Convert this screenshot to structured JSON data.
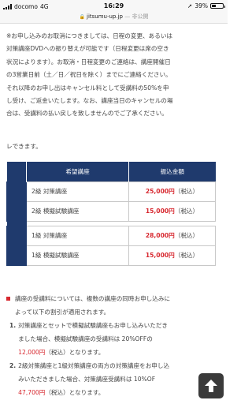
{
  "status_bar": {
    "carrier": "docomo",
    "network": "4G",
    "time": "16:29",
    "battery": "39%",
    "battery_level": 0.39
  },
  "url_bar": {
    "domain": "jitsumu-up.jp",
    "suffix": "— 非公開"
  },
  "intro": {
    "lines": [
      "※お申し込みのお取消につきましては、日程の変更、あるいは",
      "対策講座DVDへの振り替えが可能です（日程変更は席の空き",
      "状況によります）。お取消・日程変更のご連絡は、講座開催日",
      "の3営業日前（土／日／祝日を除く）までにご連絡ください。",
      "それ以降のお申し出はキャンセル料として受講料の50%を申",
      "し受け、ご返金いたします。なお、講座当日のキャンセルの場",
      "合は、受講料の払い戻しを致しませんのでご了承ください。"
    ],
    "tail": "レできます。"
  },
  "table": {
    "headers": [
      "希望講座",
      "振込金額"
    ],
    "groups": [
      {
        "rows": [
          {
            "course": "2級 対策講座",
            "amount": "25,000円",
            "tax": "（税込）"
          },
          {
            "course": "2級 模擬試験講座",
            "amount": "15,000円",
            "tax": "（税込）"
          }
        ]
      },
      {
        "rows": [
          {
            "course": "1級 対策講座",
            "amount": "28,000円",
            "tax": "（税込）"
          },
          {
            "course": "1級 模擬試験講座",
            "amount": "15,000円",
            "tax": "（税込）"
          }
        ]
      }
    ]
  },
  "notes": {
    "heading_line1": "講座の受講料については、複数の講座の同時お申し込みに",
    "heading_line2": "よって以下の割引が適用されます。",
    "item1": {
      "num": "1.",
      "line1": "対策講座とセットで模擬試験講座もお申し込みいただき",
      "line2": "ました場合、模擬試験講座の受講料は 20%OFFの",
      "price": "12,000円",
      "tax_suffix": "（税込）となります。"
    },
    "item2": {
      "num": "2.",
      "line1": "2級対策講座と1級対策講座の両方の対策講座をお申し込",
      "line2": "みいただきました場合、対策講座受講料は 10%OF",
      "price": "47,700円",
      "tax_suffix": "（税込）となります。"
    }
  }
}
